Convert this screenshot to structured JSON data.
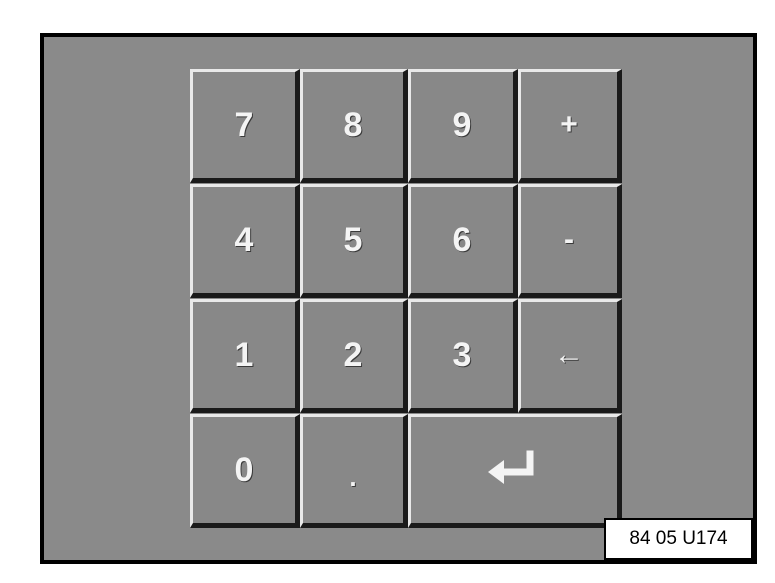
{
  "keypad": {
    "keys": {
      "k7": "7",
      "k8": "8",
      "k9": "9",
      "plus": "+",
      "k4": "4",
      "k5": "5",
      "k6": "6",
      "minus": "-",
      "k1": "1",
      "k2": "2",
      "k3": "3",
      "backspace": "←",
      "k0": "0",
      "dot": ".",
      "enter_icon": "enter-icon"
    }
  },
  "figure_code": "84 05 U174"
}
